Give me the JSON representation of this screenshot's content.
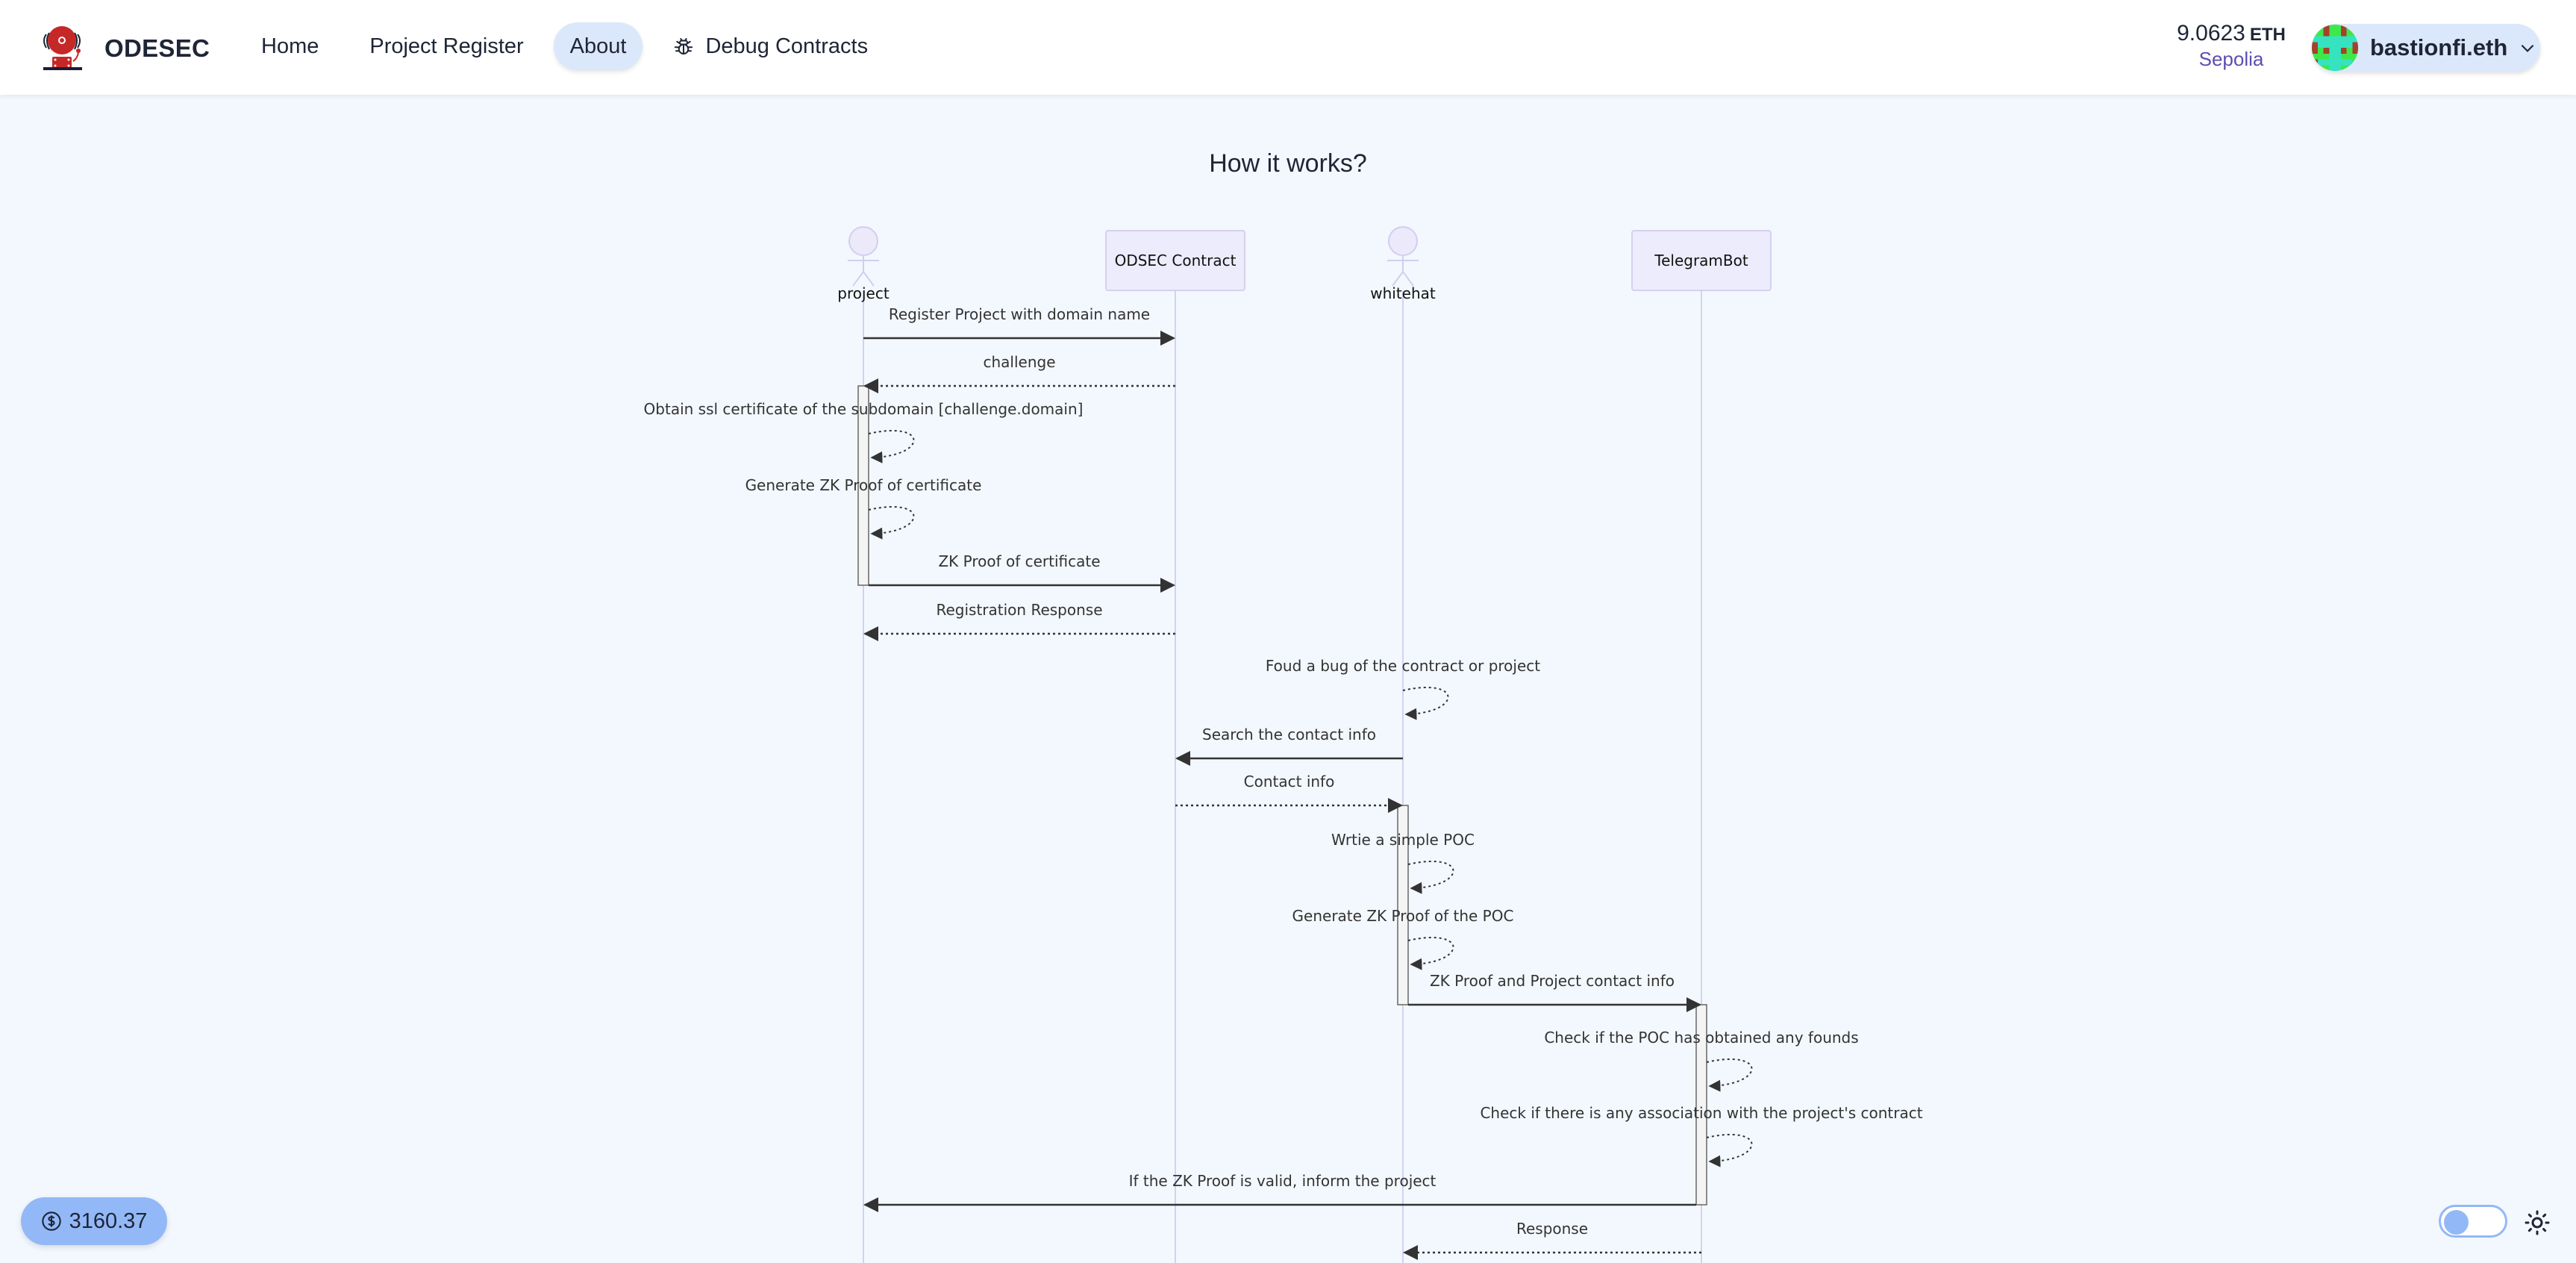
{
  "navbar": {
    "brand": "ODESEC",
    "links": [
      {
        "label": "Home",
        "active": false
      },
      {
        "label": "Project Register",
        "active": false
      },
      {
        "label": "About",
        "active": true
      },
      {
        "label": "Debug Contracts",
        "active": false,
        "icon": "bug-icon"
      }
    ],
    "balance": {
      "amount": "9.0623",
      "unit": "ETH",
      "network": "Sepolia"
    },
    "account": {
      "name": "bastionfi.eth",
      "icon": "chevron-down-icon"
    }
  },
  "page": {
    "title": "How it works?"
  },
  "diagram": {
    "type": "sequence",
    "participants": [
      {
        "id": "project",
        "label": "project",
        "kind": "actor"
      },
      {
        "id": "odsec",
        "label": "ODSEC Contract",
        "kind": "participant"
      },
      {
        "id": "whitehat",
        "label": "whitehat",
        "kind": "actor"
      },
      {
        "id": "telegram",
        "label": "TelegramBot",
        "kind": "participant"
      }
    ],
    "messages": [
      {
        "from": "project",
        "to": "odsec",
        "text": "Register Project with domain name",
        "style": "solid"
      },
      {
        "from": "odsec",
        "to": "project",
        "text": "challenge",
        "style": "dotted"
      },
      {
        "from": "project",
        "to": "project",
        "text": "Obtain ssl certificate of the subdomain [challenge.domain]",
        "style": "dotted"
      },
      {
        "from": "project",
        "to": "project",
        "text": "Generate ZK Proof of certificate",
        "style": "dotted"
      },
      {
        "from": "project",
        "to": "odsec",
        "text": "ZK Proof of certificate",
        "style": "solid"
      },
      {
        "from": "odsec",
        "to": "project",
        "text": "Registration Response",
        "style": "dotted"
      },
      {
        "from": "whitehat",
        "to": "whitehat",
        "text": "Foud a bug of the contract or project",
        "style": "dotted"
      },
      {
        "from": "whitehat",
        "to": "odsec",
        "text": "Search the contact info",
        "style": "solid"
      },
      {
        "from": "odsec",
        "to": "whitehat",
        "text": "Contact info",
        "style": "dotted"
      },
      {
        "from": "whitehat",
        "to": "whitehat",
        "text": "Wrtie a simple POC",
        "style": "dotted"
      },
      {
        "from": "whitehat",
        "to": "whitehat",
        "text": "Generate ZK Proof of the POC",
        "style": "dotted"
      },
      {
        "from": "whitehat",
        "to": "telegram",
        "text": "ZK Proof and Project contact info",
        "style": "solid"
      },
      {
        "from": "telegram",
        "to": "telegram",
        "text": "Check if the POC has obtained any founds",
        "style": "dotted"
      },
      {
        "from": "telegram",
        "to": "telegram",
        "text": "Check if there is any association with the project's contract",
        "style": "dotted"
      },
      {
        "from": "telegram",
        "to": "project",
        "text": "If the ZK Proof is valid, inform the project",
        "style": "solid"
      },
      {
        "from": "telegram",
        "to": "whitehat",
        "text": "Response",
        "style": "dotted"
      }
    ],
    "activations": [
      {
        "participant": "project",
        "from_message": 1,
        "to_message": 4
      },
      {
        "participant": "whitehat",
        "from_message": 8,
        "to_message": 11
      },
      {
        "participant": "telegram",
        "from_message": 11,
        "to_message": 14
      }
    ]
  },
  "footer": {
    "price": "3160.37",
    "price_icon": "dollar-icon",
    "theme_toggle": {
      "state": "light"
    },
    "theme_icon": "sun-icon"
  }
}
